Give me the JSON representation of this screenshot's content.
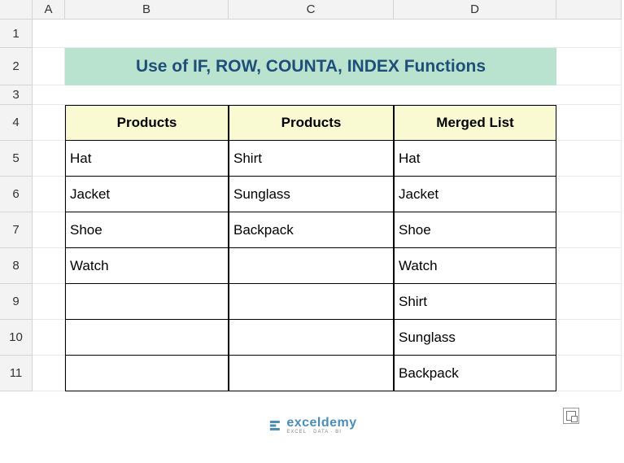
{
  "columns": [
    "A",
    "B",
    "C",
    "D"
  ],
  "rows": [
    "1",
    "2",
    "3",
    "4",
    "5",
    "6",
    "7",
    "8",
    "9",
    "10",
    "11"
  ],
  "title": "Use of IF, ROW, COUNTA, INDEX Functions",
  "headers": {
    "col_b": "Products",
    "col_c": "Products",
    "col_d": "Merged List"
  },
  "data": {
    "b": [
      "Hat",
      "Jacket",
      "Shoe",
      "Watch",
      "",
      "",
      ""
    ],
    "c": [
      "Shirt",
      "Sunglass",
      "Backpack",
      "",
      "",
      "",
      ""
    ],
    "d": [
      "Hat",
      "Jacket",
      "Shoe",
      "Watch",
      "Shirt",
      "Sunglass",
      "Backpack"
    ]
  },
  "brand": {
    "name": "exceldemy",
    "sub": "EXCEL · DATA · BI"
  },
  "chart_data": {
    "type": "table",
    "title": "Use of IF, ROW, COUNTA, INDEX Functions",
    "columns": [
      "Products",
      "Products",
      "Merged List"
    ],
    "rows": [
      [
        "Hat",
        "Shirt",
        "Hat"
      ],
      [
        "Jacket",
        "Sunglass",
        "Jacket"
      ],
      [
        "Shoe",
        "Backpack",
        "Shoe"
      ],
      [
        "Watch",
        "",
        "Watch"
      ],
      [
        "",
        "",
        "Shirt"
      ],
      [
        "",
        "",
        "Sunglass"
      ],
      [
        "",
        "",
        "Backpack"
      ]
    ]
  }
}
